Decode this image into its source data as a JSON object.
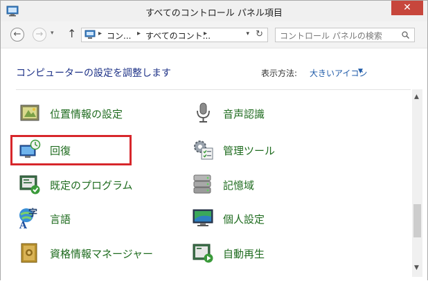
{
  "window": {
    "title": "すべてのコントロール パネル項目",
    "close_glyph": "✕"
  },
  "address": {
    "crumbs": [
      "コン...",
      "すべてのコント..."
    ],
    "separator": "▸",
    "dropdown_glyph": "▾",
    "refresh_glyph": "↻",
    "search_placeholder": "コントロール パネルの検索"
  },
  "nav": {
    "back_glyph": "←",
    "forward_glyph": "→",
    "recent_glyph": "▾",
    "up_glyph": "↑"
  },
  "content": {
    "heading": "コンピューターの設定を調整します",
    "view_label": "表示方法:",
    "view_value": "大きいアイコン",
    "view_arrow": "▼"
  },
  "scroll": {
    "up_glyph": "▲",
    "down_glyph": "▼"
  },
  "items_left": [
    {
      "label": "位置情報の設定",
      "icon": "location-settings-icon"
    },
    {
      "label": "回復",
      "icon": "recovery-icon"
    },
    {
      "label": "既定のプログラム",
      "icon": "default-programs-icon"
    },
    {
      "label": "言語",
      "icon": "language-icon"
    },
    {
      "label": "資格情報マネージャー",
      "icon": "credential-manager-icon"
    }
  ],
  "items_right": [
    {
      "label": "音声認識",
      "icon": "speech-recognition-icon"
    },
    {
      "label": "管理ツール",
      "icon": "admin-tools-icon"
    },
    {
      "label": "記憶域",
      "icon": "storage-spaces-icon"
    },
    {
      "label": "個人設定",
      "icon": "personalization-icon"
    },
    {
      "label": "自動再生",
      "icon": "autoplay-icon"
    }
  ],
  "colors": {
    "accent": "#1e6b1e",
    "link_blue": "#1e5aa8",
    "heading": "#1e3287",
    "highlight": "#d7262b",
    "close": "#c7463c"
  }
}
